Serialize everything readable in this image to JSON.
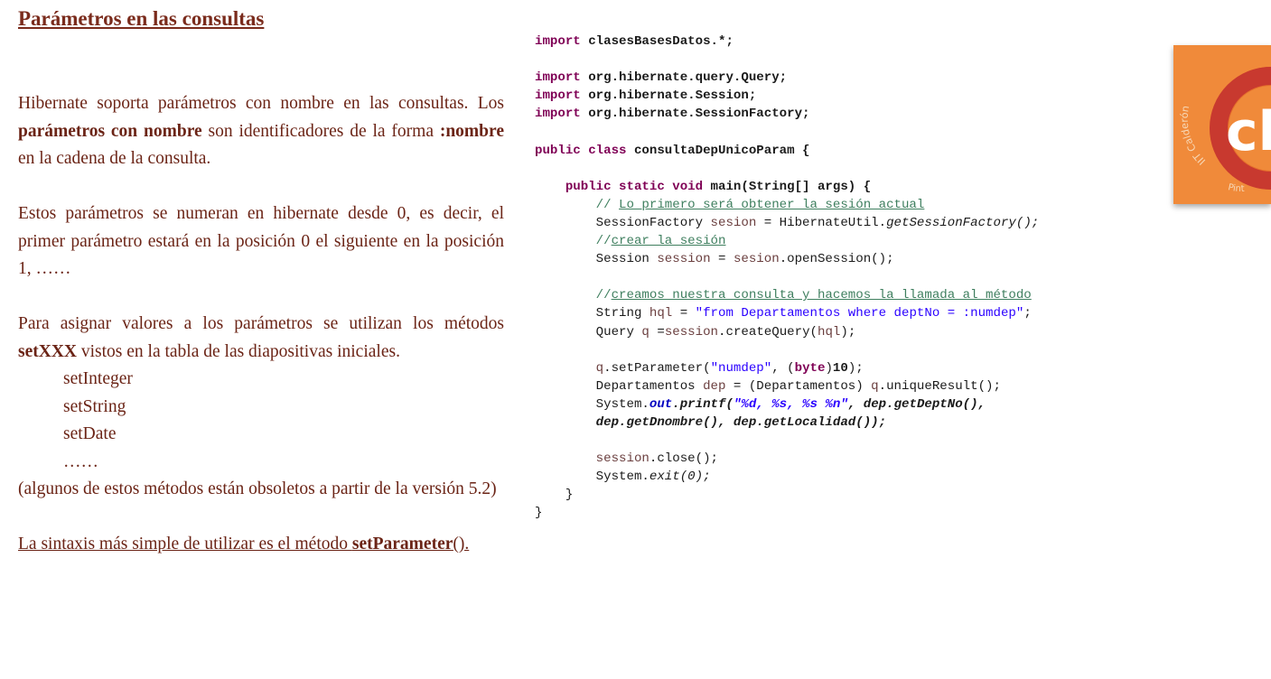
{
  "title": "Parámetros en las consultas",
  "paragraphs": {
    "p1_a": "Hibernate soporta parámetros con nombre en las consultas. Los ",
    "p1_b": "parámetros con nombre",
    "p1_c": " son identificadores de la forma ",
    "p1_d": ":nombre",
    "p1_e": " en la cadena de la consulta.",
    "p2": "Estos parámetros se numeran en hibernate desde 0, es decir, el primer parámetro estará en la posición 0 el siguiente en la posición 1, ……",
    "p3_a": "Para asignar valores a los parámetros se utilizan los métodos ",
    "p3_b": "setXXX",
    "p3_c": " vistos en la tabla de las diapositivas iniciales.",
    "methods": [
      "setInteger",
      "setString",
      "setDate",
      "……"
    ],
    "p4": "(algunos de estos métodos están obsoletos a partir de la versión 5.2)",
    "p5_a": "La sintaxis más simple de utilizar es el método ",
    "p5_b": "setParameter",
    "p5_c": "()."
  },
  "code": {
    "l1_kw": "import",
    "l1_rest": " clasesBasesDatos.*;",
    "l2_kw": "import",
    "l2_rest": " org.hibernate.query.Query;",
    "l3_kw": "import",
    "l3_rest": " org.hibernate.Session;",
    "l4_kw": "import",
    "l4_rest": " org.hibernate.SessionFactory;",
    "l5_kw": "public class",
    "l5_rest": " consultaDepUnicoParam {",
    "l6_kw": "public static void",
    "l6_rest": " main(String[] args) {",
    "l7_pre": "// ",
    "l7_u": "Lo primero será obtener la sesión actual",
    "l8_a": "SessionFactory ",
    "l8_v": "sesion",
    "l8_b": " = HibernateUtil.",
    "l8_it": "getSessionFactory();",
    "l9_pre": "//",
    "l9_u": "crear la sesión",
    "l10_a": "Session ",
    "l10_v": "session",
    "l10_b": " = ",
    "l10_v2": "sesion",
    "l10_c": ".openSession();",
    "l11_pre": "//",
    "l11_u": "creamos nuestra consulta y hacemos la llamada al método",
    "l12_a": "String ",
    "l12_v": "hql",
    "l12_b": " = ",
    "l12_s": "\"from Departamentos where deptNo = :numdep\"",
    "l12_c": ";",
    "l13_a": "Query ",
    "l13_v": "q",
    "l13_b": " =",
    "l13_v2": "session",
    "l13_c": ".createQuery(",
    "l13_v3": "hql",
    "l13_d": ");",
    "l14_v": "q",
    "l14_a": ".setParameter(",
    "l14_s": "\"numdep\"",
    "l14_b": ", (",
    "l14_kw": "byte",
    "l14_c": ")",
    "l14_n": "10",
    "l14_d": ");",
    "l15_a": "Departamentos ",
    "l15_v": "dep",
    "l15_b": " = (Departamentos) ",
    "l15_v2": "q",
    "l15_c": ".uniqueResult();",
    "l16_a": "System.",
    "l16_out": "out",
    "l16_pf": ".printf(",
    "l16_s": "\"%d, %s, %s %n\"",
    "l16_b": ", ",
    "l16_call": "dep.getDeptNo(),",
    "l17": "dep.getDnombre(), dep.getLocalidad());",
    "l18_v": "session",
    "l18_a": ".close();",
    "l19_a": "System.",
    "l19_it": "exit(0);",
    "l20": "}",
    "l21": "}"
  },
  "logo": {
    "arc_text_top": "IIT Calderón",
    "arc_text_bottom": "Pint",
    "mark": "cl",
    "colors": {
      "bg": "#f08a3a",
      "ring": "#c8392f",
      "mark": "#ffffff"
    }
  }
}
